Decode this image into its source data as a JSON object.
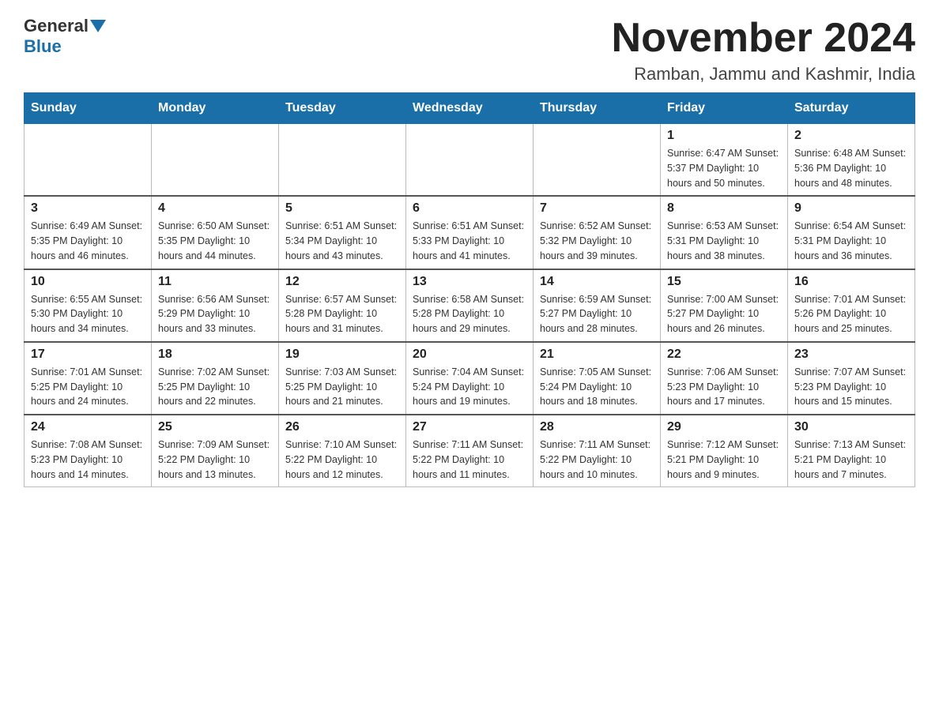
{
  "header": {
    "logo_general": "General",
    "logo_blue": "Blue",
    "title": "November 2024",
    "subtitle": "Ramban, Jammu and Kashmir, India"
  },
  "days_of_week": [
    "Sunday",
    "Monday",
    "Tuesday",
    "Wednesday",
    "Thursday",
    "Friday",
    "Saturday"
  ],
  "weeks": [
    {
      "days": [
        {
          "number": "",
          "info": ""
        },
        {
          "number": "",
          "info": ""
        },
        {
          "number": "",
          "info": ""
        },
        {
          "number": "",
          "info": ""
        },
        {
          "number": "",
          "info": ""
        },
        {
          "number": "1",
          "info": "Sunrise: 6:47 AM\nSunset: 5:37 PM\nDaylight: 10 hours and 50 minutes."
        },
        {
          "number": "2",
          "info": "Sunrise: 6:48 AM\nSunset: 5:36 PM\nDaylight: 10 hours and 48 minutes."
        }
      ]
    },
    {
      "days": [
        {
          "number": "3",
          "info": "Sunrise: 6:49 AM\nSunset: 5:35 PM\nDaylight: 10 hours and 46 minutes."
        },
        {
          "number": "4",
          "info": "Sunrise: 6:50 AM\nSunset: 5:35 PM\nDaylight: 10 hours and 44 minutes."
        },
        {
          "number": "5",
          "info": "Sunrise: 6:51 AM\nSunset: 5:34 PM\nDaylight: 10 hours and 43 minutes."
        },
        {
          "number": "6",
          "info": "Sunrise: 6:51 AM\nSunset: 5:33 PM\nDaylight: 10 hours and 41 minutes."
        },
        {
          "number": "7",
          "info": "Sunrise: 6:52 AM\nSunset: 5:32 PM\nDaylight: 10 hours and 39 minutes."
        },
        {
          "number": "8",
          "info": "Sunrise: 6:53 AM\nSunset: 5:31 PM\nDaylight: 10 hours and 38 minutes."
        },
        {
          "number": "9",
          "info": "Sunrise: 6:54 AM\nSunset: 5:31 PM\nDaylight: 10 hours and 36 minutes."
        }
      ]
    },
    {
      "days": [
        {
          "number": "10",
          "info": "Sunrise: 6:55 AM\nSunset: 5:30 PM\nDaylight: 10 hours and 34 minutes."
        },
        {
          "number": "11",
          "info": "Sunrise: 6:56 AM\nSunset: 5:29 PM\nDaylight: 10 hours and 33 minutes."
        },
        {
          "number": "12",
          "info": "Sunrise: 6:57 AM\nSunset: 5:28 PM\nDaylight: 10 hours and 31 minutes."
        },
        {
          "number": "13",
          "info": "Sunrise: 6:58 AM\nSunset: 5:28 PM\nDaylight: 10 hours and 29 minutes."
        },
        {
          "number": "14",
          "info": "Sunrise: 6:59 AM\nSunset: 5:27 PM\nDaylight: 10 hours and 28 minutes."
        },
        {
          "number": "15",
          "info": "Sunrise: 7:00 AM\nSunset: 5:27 PM\nDaylight: 10 hours and 26 minutes."
        },
        {
          "number": "16",
          "info": "Sunrise: 7:01 AM\nSunset: 5:26 PM\nDaylight: 10 hours and 25 minutes."
        }
      ]
    },
    {
      "days": [
        {
          "number": "17",
          "info": "Sunrise: 7:01 AM\nSunset: 5:25 PM\nDaylight: 10 hours and 24 minutes."
        },
        {
          "number": "18",
          "info": "Sunrise: 7:02 AM\nSunset: 5:25 PM\nDaylight: 10 hours and 22 minutes."
        },
        {
          "number": "19",
          "info": "Sunrise: 7:03 AM\nSunset: 5:25 PM\nDaylight: 10 hours and 21 minutes."
        },
        {
          "number": "20",
          "info": "Sunrise: 7:04 AM\nSunset: 5:24 PM\nDaylight: 10 hours and 19 minutes."
        },
        {
          "number": "21",
          "info": "Sunrise: 7:05 AM\nSunset: 5:24 PM\nDaylight: 10 hours and 18 minutes."
        },
        {
          "number": "22",
          "info": "Sunrise: 7:06 AM\nSunset: 5:23 PM\nDaylight: 10 hours and 17 minutes."
        },
        {
          "number": "23",
          "info": "Sunrise: 7:07 AM\nSunset: 5:23 PM\nDaylight: 10 hours and 15 minutes."
        }
      ]
    },
    {
      "days": [
        {
          "number": "24",
          "info": "Sunrise: 7:08 AM\nSunset: 5:23 PM\nDaylight: 10 hours and 14 minutes."
        },
        {
          "number": "25",
          "info": "Sunrise: 7:09 AM\nSunset: 5:22 PM\nDaylight: 10 hours and 13 minutes."
        },
        {
          "number": "26",
          "info": "Sunrise: 7:10 AM\nSunset: 5:22 PM\nDaylight: 10 hours and 12 minutes."
        },
        {
          "number": "27",
          "info": "Sunrise: 7:11 AM\nSunset: 5:22 PM\nDaylight: 10 hours and 11 minutes."
        },
        {
          "number": "28",
          "info": "Sunrise: 7:11 AM\nSunset: 5:22 PM\nDaylight: 10 hours and 10 minutes."
        },
        {
          "number": "29",
          "info": "Sunrise: 7:12 AM\nSunset: 5:21 PM\nDaylight: 10 hours and 9 minutes."
        },
        {
          "number": "30",
          "info": "Sunrise: 7:13 AM\nSunset: 5:21 PM\nDaylight: 10 hours and 7 minutes."
        }
      ]
    }
  ]
}
